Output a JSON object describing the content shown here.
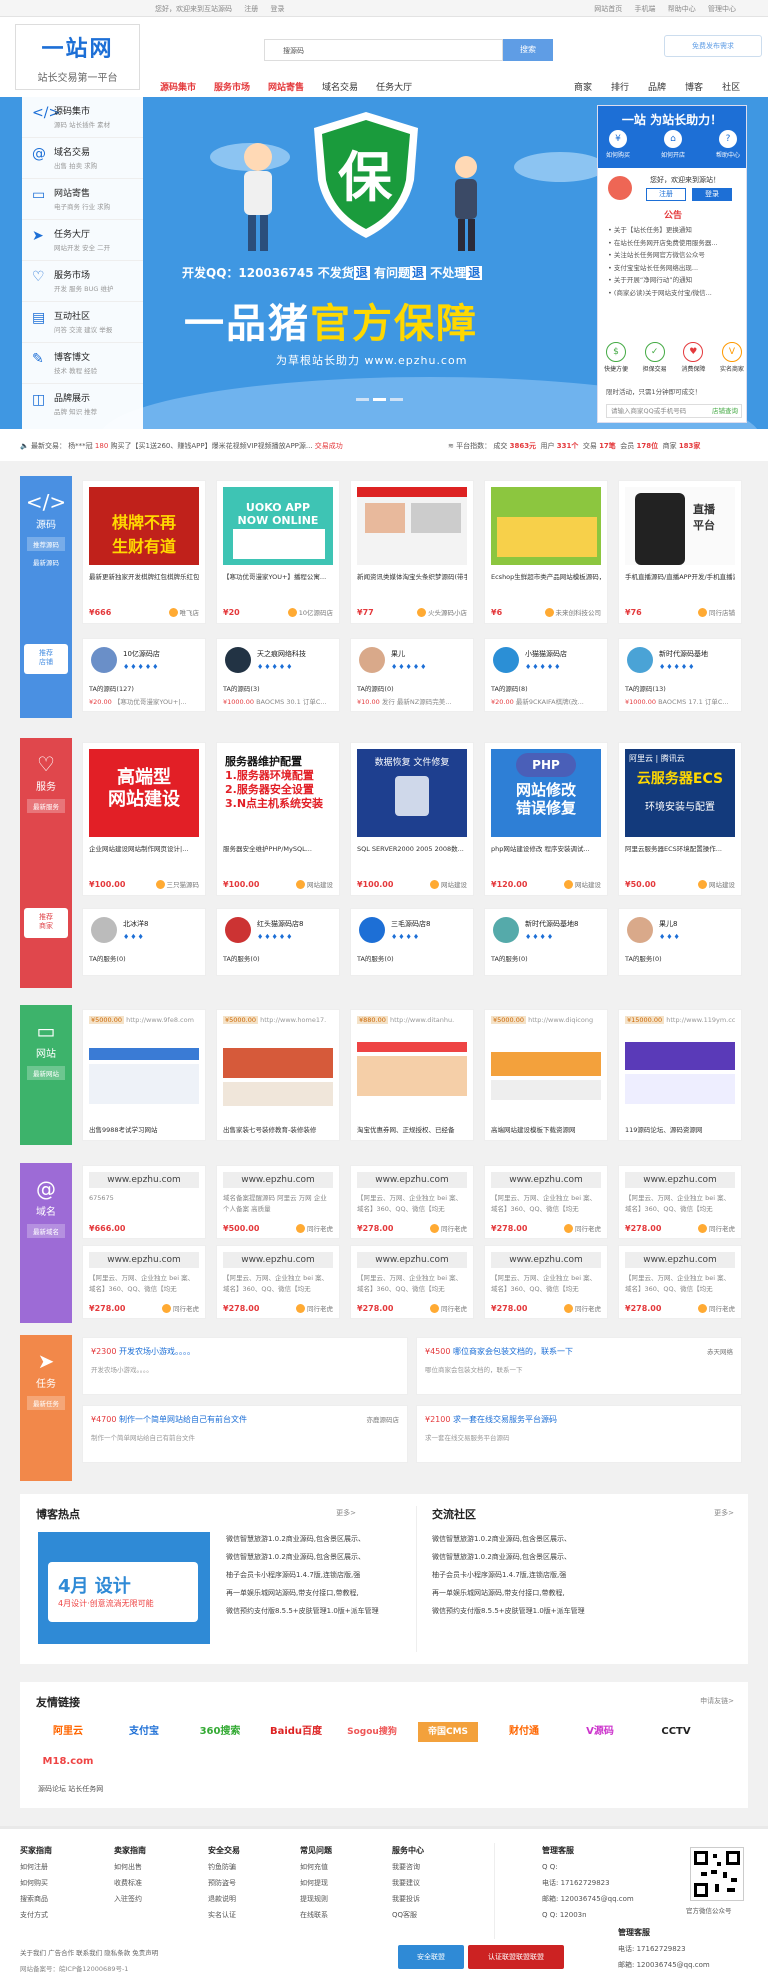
{
  "topbar": {
    "greeting": "您好，欢迎来到互站源码",
    "register": "注册",
    "login": "登录",
    "links": [
      "网站首页",
      "手机端",
      "帮助中心",
      "管理中心"
    ]
  },
  "header": {
    "logo_text": "一站网",
    "slogan": "站长交易第一平台",
    "search_value": "搜源码",
    "search_btn": "搜索",
    "publish_btn": "免费发布需求",
    "nav_left": [
      "源码集市",
      "服务市场",
      "网站寄售",
      "域名交易",
      "任务大厅"
    ],
    "nav_right": [
      "商家",
      "排行",
      "品牌",
      "博客",
      "社区"
    ]
  },
  "categories": [
    {
      "icon": "</>",
      "title": "源码集市",
      "sub": "源码 站长插件 素材"
    },
    {
      "icon": "@",
      "title": "域名交易",
      "sub": "出售 拍卖 求购"
    },
    {
      "icon": "▭",
      "title": "网站寄售",
      "sub": "电子商务 行业 求购"
    },
    {
      "icon": "➤",
      "title": "任务大厅",
      "sub": "网站开发 安全 二开"
    },
    {
      "icon": "♡",
      "title": "服务市场",
      "sub": "开发 服务 BUG 维护"
    },
    {
      "icon": "▤",
      "title": "互动社区",
      "sub": "问答 交流 建议 举报"
    },
    {
      "icon": "✎",
      "title": "博客博文",
      "sub": "技术 教程 经验"
    },
    {
      "icon": "◫",
      "title": "品牌展示",
      "sub": "品牌 知识 推荐"
    }
  ],
  "banner": {
    "shield": "保",
    "line1_prefix": "开发QQ：120036745",
    "line1": [
      "不发货",
      "退",
      "有问题",
      "退",
      "不处理",
      "退"
    ],
    "line2a": "一品猪",
    "line2b": "官方保障",
    "line3": "为草根站长助力   www.epzhu.com"
  },
  "panel": {
    "head": "一站 为站长助力！",
    "tabs": [
      "如何购买",
      "如何开店",
      "帮助中心"
    ],
    "hello": "您好，欢迎来到源站！",
    "register": "注册",
    "login": "登录",
    "notice_title": "公告",
    "notices": [
      "关于【站长任务】更换通知",
      "在站长任务网开店免费使用服务器...",
      "关注站长任务网官方微信公众号",
      "支付宝宝站长任务网络出现...",
      "关于开展“净网行动”的通知",
      "(商家必读)关于网站支付宝/微信..."
    ],
    "services": [
      "快捷方便",
      "担保交易",
      "消费保障",
      "实名商家"
    ],
    "sale_line": "限时活动，只需1分钟即可成交！",
    "input_placeholder": "请输入商家QQ或手机号码",
    "input_btn": "店铺查询"
  },
  "ticker": {
    "label": "最新交易：",
    "user": "杨***冠",
    "amount": "180",
    "text": "购买了【买1送260、赚钱APP】爆米花视频VIP视频播放APP源...",
    "state": "交易成功",
    "stats_label": "平台指数：",
    "stats": [
      {
        "k": "成交",
        "v": "3863元"
      },
      {
        "k": "用户",
        "v": "331个"
      },
      {
        "k": "交易",
        "v": "17笔"
      },
      {
        "k": "会员",
        "v": "178位"
      },
      {
        "k": "商家",
        "v": "183家"
      }
    ]
  },
  "sections": {
    "source": {
      "name": "源码",
      "tag1": "推荐源码",
      "tag2": "最新源码",
      "recommend": "推荐\n店铺",
      "items": [
        {
          "title": "最新更新独家开发棋牌红包棋牌乐红包版",
          "price": "¥666",
          "shop": "唯飞店"
        },
        {
          "title": "【寒功优哥漫家YOU+】播程公寓...",
          "price": "¥20",
          "shop": "10亿源码店"
        },
        {
          "title": "新闻资讯类媒体淘宝头条织梦源码(带手...",
          "price": "¥77",
          "shop": "火头源码小店"
        },
        {
          "title": "Ecshop生鲜超市类产品网站模板源码，PC...",
          "price": "¥6",
          "shop": "未来创科技公司"
        },
        {
          "title": "手机直播源码/直播APP开发/手机直播源码",
          "price": "¥76",
          "shop": "同行店铺"
        }
      ],
      "shops": [
        {
          "name": "10亿源码店",
          "line": "TA的源码(127)",
          "price": "¥20.00",
          "desc": "【寒功优哥漫家YOU+|..."
        },
        {
          "name": "天之痕网络科技",
          "line": "TA的源码(3)",
          "price": "¥1000.00",
          "desc": "BAOCMS 30.1 订单C..."
        },
        {
          "name": "果儿",
          "line": "TA的源码(0)",
          "price": "¥10.00",
          "desc": "发行 最新NZ源码完美..."
        },
        {
          "name": "小猫猫源码店",
          "line": "TA的源码(8)",
          "price": "¥20.00",
          "desc": "最新9CKAIFA棋牌(改..."
        },
        {
          "name": "新时代源码基地",
          "line": "TA的源码(13)",
          "price": "¥1000.00",
          "desc": "BAOCMS 17.1 订单C..."
        }
      ]
    },
    "service": {
      "name": "服务",
      "tag1": "最新服务",
      "recommend": "推荐\n商家",
      "items": [
        {
          "img": "高端型网站建设",
          "title": "企业网站建设网站制作网页设计|...",
          "price": "¥100.00",
          "shop": "三只猫源码"
        },
        {
          "img": "服务器维护配置",
          "title": "服务器安全维护PHP/MySQL...",
          "price": "¥100.00",
          "shop": "网站建设"
        },
        {
          "img": "数据恢复",
          "title": "SQL SERVER2000 2005 2008数...",
          "price": "¥100.00",
          "shop": "网站建设"
        },
        {
          "img": "网站修改错误修复",
          "title": "php网站建设修改 程序安装调试...",
          "price": "¥120.00",
          "shop": "网站建设"
        },
        {
          "img": "云服务器ECS",
          "title": "阿里云服务器ECS环境配置操作...",
          "price": "¥50.00",
          "shop": "网站建设"
        }
      ],
      "shops": [
        {
          "name": "北冰洋8",
          "line": "TA的服务(0)"
        },
        {
          "name": "红头猫源码店8",
          "line": "TA的服务(0)"
        },
        {
          "name": "三毛源码店8",
          "line": "TA的服务(0)"
        },
        {
          "name": "新时代源码基地8",
          "line": "TA的服务(0)"
        },
        {
          "name": "果儿8",
          "line": "TA的服务(0)"
        }
      ]
    },
    "site": {
      "name": "网站",
      "tag1": "最新网站",
      "items": [
        {
          "price": "¥5000.00",
          "url": "http://www.9fe8.com",
          "title": "出售9988考试学习网站"
        },
        {
          "price": "¥5000.00",
          "url": "http://www.home17.",
          "title": "出售家装七号装修教育-装修装修"
        },
        {
          "price": "¥880.00",
          "url": "http://www.ditanhu.",
          "title": "淘宝优惠券网、正规授权、已经备"
        },
        {
          "price": "¥5000.00",
          "url": "http://www.diqicong",
          "title": "高端网站建设模板下载资源网"
        },
        {
          "price": "¥15000.00",
          "url": "http://www.119ym.cc",
          "title": "119源码论坛、源码资源网"
        }
      ]
    },
    "domain": {
      "name": "域名",
      "tag1": "最新域名",
      "row1": [
        {
          "domain": "www.epzhu.com",
          "desc": "675675",
          "price": "¥666.00",
          "shop": ""
        },
        {
          "domain": "www.epzhu.com",
          "desc": "域名备案提醒源码 阿里云 万网 企业个人备案 高质量",
          "price": "¥500.00",
          "shop": "同行老虎"
        },
        {
          "domain": "www.epzhu.com",
          "desc": "【阿里云、万网、企业独立 bei 案、域名】360、QQ、微信【均无",
          "price": "¥278.00",
          "shop": "同行老虎"
        },
        {
          "domain": "www.epzhu.com",
          "desc": "【阿里云、万网、企业独立 bei 案、域名】360、QQ、微信【均无",
          "price": "¥278.00",
          "shop": "同行老虎"
        },
        {
          "domain": "www.epzhu.com",
          "desc": "【阿里云、万网、企业独立 bei 案、域名】360、QQ、微信【均无",
          "price": "¥278.00",
          "shop": "同行老虎"
        }
      ],
      "row2": [
        {
          "domain": "www.epzhu.com",
          "desc": "【阿里云、万网、企业独立 bei 案、域名】360、QQ、微信【均无",
          "price": "¥278.00",
          "shop": "同行老虎"
        },
        {
          "domain": "www.epzhu.com",
          "desc": "【阿里云、万网、企业独立 bei 案、域名】360、QQ、微信【均无",
          "price": "¥278.00",
          "shop": "同行老虎"
        },
        {
          "domain": "www.epzhu.com",
          "desc": "【阿里云、万网、企业独立 bei 案、域名】360、QQ、微信【均无",
          "price": "¥278.00",
          "shop": "同行老虎"
        },
        {
          "domain": "www.epzhu.com",
          "desc": "【阿里云、万网、企业独立 bei 案、域名】360、QQ、微信【均无",
          "price": "¥278.00",
          "shop": "同行老虎"
        },
        {
          "domain": "www.epzhu.com",
          "desc": "【阿里云、万网、企业独立 bei 案、域名】360、QQ、微信【均无",
          "price": "¥278.00",
          "shop": "同行老虎"
        }
      ]
    },
    "task": {
      "name": "任务",
      "tag1": "最新任务",
      "items": [
        {
          "price": "¥2300",
          "title": "开发农场小游戏。。。。",
          "desc": "开发农场小游戏。。。。",
          "user": ""
        },
        {
          "price": "¥4500",
          "title": "哪位商家会包装文档的，联系一下",
          "desc": "哪位商家会包装文档的，联系一下",
          "user": "赤天网络"
        },
        {
          "price": "¥4700",
          "title": "制作一个简单网站给自己有前台文件",
          "desc": "制作一个简单网站给自己有前台文件",
          "user": "亦鹿源码店"
        },
        {
          "price": "¥2100",
          "title": "求一套在线交易服务平台源码",
          "desc": "求一套在线交易服务平台源码",
          "user": ""
        }
      ]
    }
  },
  "blog": {
    "title": "博客热点",
    "more": "更多>",
    "img_text": "4月设计·创意流淌无限可能",
    "items": [
      "微信智慧旅游1.0.2商业源码,包含景区展示、",
      "微信智慧旅游1.0.2商业源码,包含景区展示、",
      "柚子会员卡小程序源码1.4.7版,连锁店版,强",
      "再一单娱乐城网站源码,带支付接口,带教程,",
      "微信预约支付版8.5.5+皮肤管理1.0版+派车管理"
    ]
  },
  "community": {
    "title": "交流社区",
    "more": "更多>",
    "items": [
      "微信智慧旅游1.0.2商业源码,包含景区展示、",
      "微信智慧旅游1.0.2商业源码,包含景区展示、",
      "柚子会员卡小程序源码1.4.7版,连锁店版,强",
      "再一单娱乐城网站源码,带支付接口,带教程,",
      "微信预约支付版8.5.5+皮肤管理1.0版+派车管理"
    ]
  },
  "links": {
    "title": "友情链接",
    "apply": "申请友链>",
    "logos": [
      "阿里云",
      "支付宝",
      "360搜索",
      "Baidu百度",
      "Sogou搜狗",
      "帝国CMS",
      "财付通",
      "V源码",
      "CCTV",
      "M18.com"
    ],
    "text_links": "源码论坛  站长任务网"
  },
  "footer": {
    "cols": [
      {
        "title": "买家指南",
        "items": [
          "如何注册",
          "如何购买",
          "搜索商品",
          "支付方式"
        ]
      },
      {
        "title": "卖家指南",
        "items": [
          "如何出售",
          "收费标准",
          "入驻签约"
        ]
      },
      {
        "title": "安全交易",
        "items": [
          "钓鱼防骗",
          "预防盗号",
          "退款说明",
          "实名认证"
        ]
      },
      {
        "title": "常见问题",
        "items": [
          "如何充值",
          "如何提现",
          "提现规则",
          "在线联系"
        ]
      },
      {
        "title": "服务中心",
        "items": [
          "我要咨询",
          "我要建议",
          "我要投诉",
          "QQ客服"
        ]
      }
    ],
    "service_title": "管理客服",
    "qq_label": "Q Q:",
    "phone_label": "电话:",
    "phone": "17162729823",
    "email_label": "邮箱:",
    "email": "120036745@qq.com",
    "qq2": "12003n",
    "qr_caption": "官方微信公众号",
    "bottom_links": "关于我们  广告合作  联系我们  隐私条款  免责声明",
    "icp": "网站备案号：皖ICP备12000689号-1",
    "badge1": "安全联盟",
    "badge2": "认证联盟联盟联盟"
  }
}
